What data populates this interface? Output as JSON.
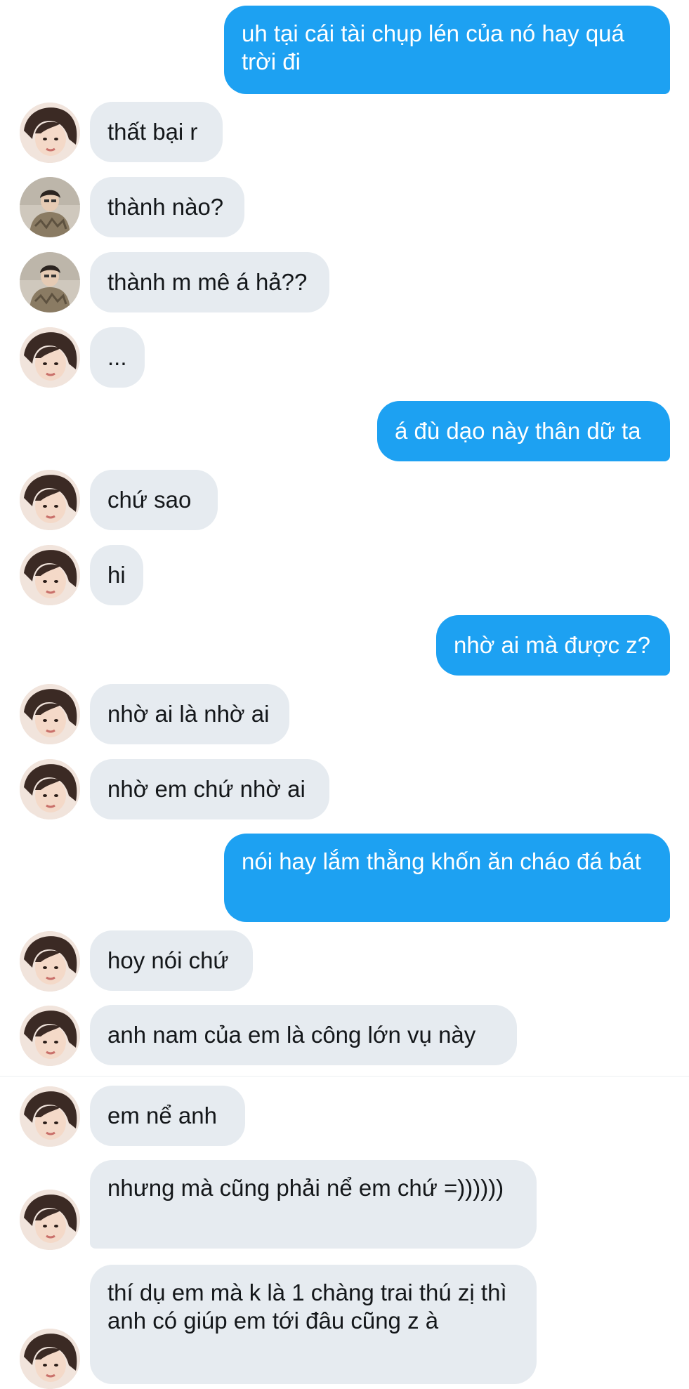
{
  "messages": [
    {
      "sender": "me",
      "text": "uh tại cái tài chụp lén của nó hay quá trời đi"
    },
    {
      "sender": "them",
      "avatar": "girl-avatar",
      "text": "thất bại r"
    },
    {
      "sender": "them",
      "avatar": "boy-avatar",
      "text": "thành nào?"
    },
    {
      "sender": "them",
      "avatar": "boy-avatar",
      "text": "thành m mê á hả??"
    },
    {
      "sender": "them",
      "avatar": "girl-avatar",
      "text": "..."
    },
    {
      "sender": "me",
      "text": "á đù dạo này thân dữ ta"
    },
    {
      "sender": "them",
      "avatar": "girl-avatar",
      "text": "chứ sao"
    },
    {
      "sender": "them",
      "avatar": "girl-avatar",
      "text": "hi"
    },
    {
      "sender": "me",
      "text": "nhờ ai mà được z?"
    },
    {
      "sender": "them",
      "avatar": "girl-avatar",
      "text": "nhờ ai là nhờ ai"
    },
    {
      "sender": "them",
      "avatar": "girl-avatar",
      "text": "nhờ em chứ nhờ ai"
    },
    {
      "sender": "me",
      "text": "nói hay lắm thằng khốn ăn cháo đá bát"
    },
    {
      "sender": "them",
      "avatar": "girl-avatar",
      "text": "hoy nói chứ"
    },
    {
      "sender": "them",
      "avatar": "girl-avatar",
      "text": "anh nam của em là công lớn vụ này"
    },
    {
      "sender": "them",
      "avatar": "girl-avatar",
      "text": "em nể anh"
    },
    {
      "sender": "them",
      "avatar": "girl-avatar",
      "text": "nhưng mà cũng phải nể em chứ =))))))"
    },
    {
      "sender": "them",
      "avatar": "girl-avatar",
      "text": "thí dụ em mà k là 1 chàng trai thú zị thì anh có giúp em tới đâu cũng z à"
    }
  ],
  "colors": {
    "outgoing_bubble": "#1da1f2",
    "incoming_bubble": "#e6ebf0",
    "background": "#ffffff"
  }
}
